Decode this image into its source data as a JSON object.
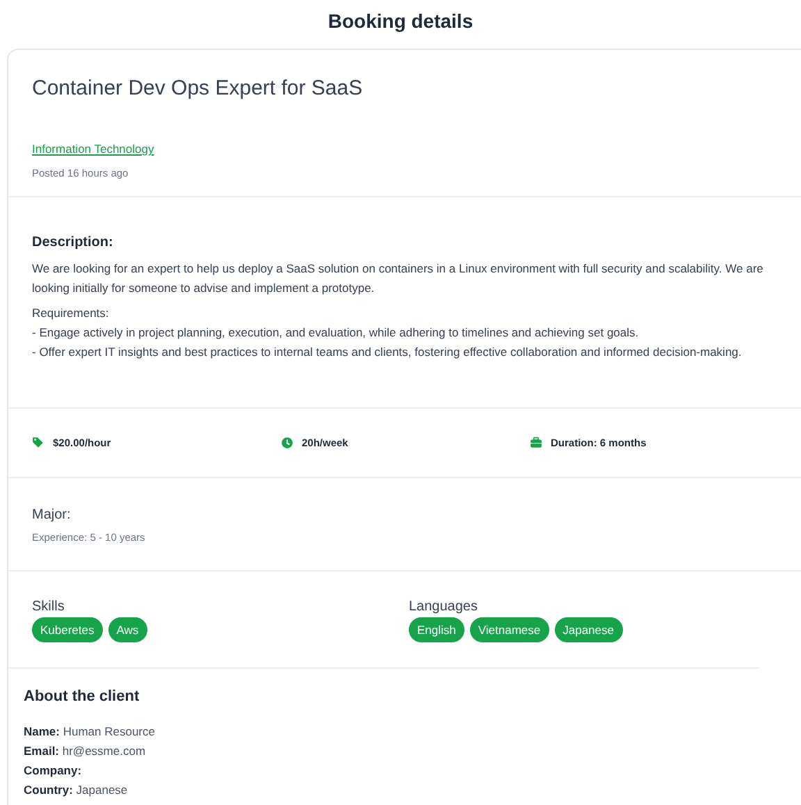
{
  "page_title": "Booking details",
  "job": {
    "title": "Container Dev Ops Expert for SaaS",
    "category": "Information Technology",
    "posted": "Posted 16 hours ago"
  },
  "description": {
    "heading": "Description:",
    "paragraphs": [
      "We are looking for an expert to help us deploy a SaaS solution on containers in a Linux environment with full security and scalability. We are looking initially for someone to advise and implement a prototype.",
      "Requirements:\n- Engage actively in project planning, execution, and evaluation, while adhering to timelines and achieving set goals.\n- Offer expert IT insights and best practices to internal teams and clients, fostering effective collaboration and informed decision-making."
    ]
  },
  "facts": [
    {
      "kind": "rate",
      "text": "$20.00/hour"
    },
    {
      "kind": "hours",
      "text": "20h/week"
    },
    {
      "kind": "duration",
      "text": "Duration: 6 months"
    }
  ],
  "major": {
    "heading": "Major:",
    "experience": "Experience: 5 - 10 years"
  },
  "skills": {
    "heading": "Skills",
    "tags": [
      "Kuberetes",
      "Aws"
    ]
  },
  "languages": {
    "heading": "Languages",
    "tags": [
      "English",
      "Vietnamese",
      "Japanese"
    ]
  },
  "client": {
    "heading": "About the client",
    "fields": [
      "**Name:** Human Resource",
      "**Email:** hr@essme.com",
      "**Company:**",
      "**Country:** Japanese"
    ]
  }
}
